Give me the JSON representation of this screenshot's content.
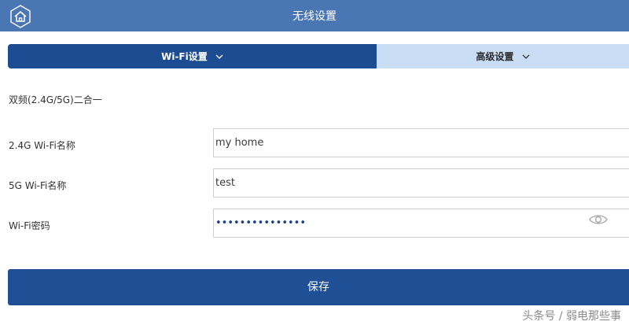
{
  "header": {
    "title": "无线设置",
    "home_icon": "home-icon"
  },
  "tabs": [
    {
      "label": "Wi-Fi设置",
      "active": true
    },
    {
      "label": "高级设置",
      "active": false
    }
  ],
  "section": {
    "mode_label": "双频(2.4G/5G)二合一"
  },
  "fields": {
    "ssid_24g": {
      "label": "2.4G Wi-Fi名称",
      "value": "my home"
    },
    "ssid_5g": {
      "label": "5G Wi-Fi名称",
      "value": "test"
    },
    "password": {
      "label": "Wi-Fi密码",
      "value": "•••••••••••••••",
      "toggle_icon": "eye-icon"
    }
  },
  "actions": {
    "save_label": "保存"
  },
  "watermark": "头条号 / 弱电那些事",
  "colors": {
    "header": "#4a76b4",
    "tab_active": "#1c4d93",
    "tab_inactive": "#c9ddf5",
    "button": "#1f4f95"
  }
}
